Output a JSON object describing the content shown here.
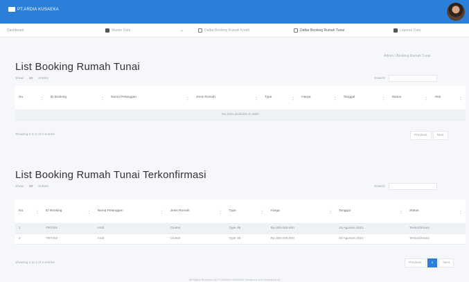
{
  "header": {
    "brand": "PT.ARDIA KUSAEKA",
    "colors": {
      "primary": "#2b7fd8",
      "background": "#f6f7fb"
    },
    "avatar_icon": "user-avatar"
  },
  "nav": {
    "dashboard": "Dashboard",
    "items": [
      {
        "label": "Master Data",
        "icon": "database-icon"
      },
      {
        "label": "Daftar Booking Rumah Kredit",
        "icon": "calendar-icon"
      },
      {
        "label": "Daftar Booking Rumah Tunai",
        "icon": "calendar-icon"
      },
      {
        "label": "Laporan Data",
        "icon": "document-icon"
      }
    ]
  },
  "breadcrumb": "Admin / Booking Rumah Tunai",
  "section1": {
    "title": "List Booking Rumah Tunai",
    "show": "Show",
    "entries": "10",
    "entries_label": "entries",
    "search_label": "Search:",
    "headers": [
      "No.",
      "ID Booking",
      "Nama Pelanggan",
      "Jenis Rumah",
      "Type",
      "Harga",
      "Tanggal",
      "Status",
      "Aksi"
    ],
    "empty": "No data available in table",
    "info": "Showing 0 to 0 of 0 entries",
    "previous": "Previous",
    "next": "Next"
  },
  "section2": {
    "title": "List Booking Rumah Tunai Terkonfirmasi",
    "show": "Show",
    "entries": "10",
    "entries_label": "entries",
    "search_label": "Search:",
    "headers": [
      "No.",
      "ID Booking",
      "Nama Pelanggan",
      "Jenis Rumah",
      "Type",
      "Harga",
      "Tanggal",
      "Status"
    ],
    "rows": [
      [
        "1",
        "TRT001",
        "Andi",
        "Cluster",
        "Type 36",
        "Rp.300.000.000",
        "15 Agustus 2021",
        "Terkonfirmasi"
      ],
      [
        "2",
        "TRT002",
        "Andi",
        "Cluster",
        "Type 36",
        "Rp.300.000.000",
        "20 Agustus 2021",
        "Terkonfirmasi"
      ]
    ],
    "info": "Showing 1 to 2 of 2 entries",
    "previous": "Previous",
    "page": "1",
    "next": "Next"
  },
  "footer": "All Rights Reserved by PT.ARDIA KUSAEKA. Designed and Developed by"
}
